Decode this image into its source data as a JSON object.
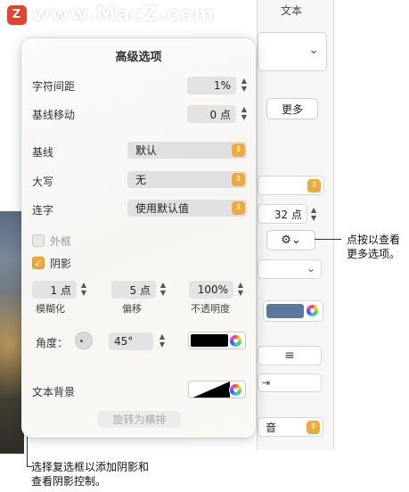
{
  "watermark": {
    "text": "www.MacZ.com",
    "logo_glyph": "Z"
  },
  "sidebar": {
    "header": "文本",
    "more_button": "更多",
    "font_size_value": "32 点",
    "line_align_icon": "≡",
    "indent_icon": "⇥",
    "language_partial": "音",
    "shadow_color_hex": "#5878a0"
  },
  "popover": {
    "title": "高级选项",
    "char_spacing": {
      "label": "字符间距",
      "value": "1%"
    },
    "baseline_shift": {
      "label": "基线移动",
      "value": "0 点"
    },
    "baseline": {
      "label": "基线",
      "value": "默认"
    },
    "capitalization": {
      "label": "大写",
      "value": "无"
    },
    "ligatures": {
      "label": "连字",
      "value": "使用默认值"
    },
    "outline": {
      "label": "外框",
      "checked": false
    },
    "shadow": {
      "label": "阴影",
      "checked": true,
      "blur": {
        "value": "1 点",
        "caption": "模糊化"
      },
      "offset": {
        "value": "5 点",
        "caption": "偏移"
      },
      "opacity": {
        "value": "100%",
        "caption": "不透明度"
      },
      "angle": {
        "label": "角度：",
        "value": "45°"
      },
      "color_hex": "#000000"
    },
    "text_background": {
      "label": "文本背景"
    },
    "rotate_button": "旋转为横排"
  },
  "callouts": {
    "right": [
      "点按以查看",
      "更多选项。"
    ],
    "bottom": [
      "选择复选框以添加阴影和",
      "查看阴影控制。"
    ]
  },
  "colors": {
    "accent": "#f2a93b"
  }
}
